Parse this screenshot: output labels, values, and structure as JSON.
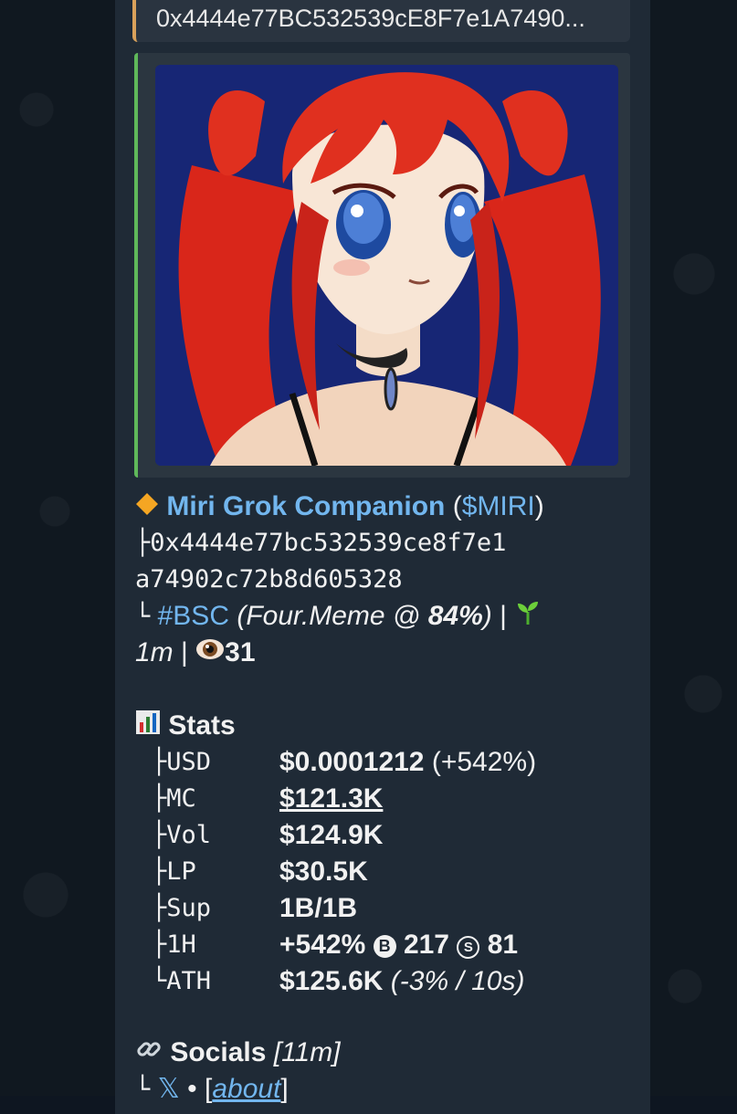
{
  "reply": {
    "text": "0x4444e77BC532539cE8F7e1A7490..."
  },
  "token": {
    "name": "Miri Grok Companion",
    "ticker": "$MIRI",
    "address_line1": "0x4444e77bc532539ce8f7e1",
    "address_line2": "a74902c72b8d605328",
    "chain": "#BSC",
    "launchpad": "(Four.Meme @ ",
    "progress": "84%",
    "progress_close": ")",
    "age": "1m",
    "views": "31"
  },
  "stats": {
    "heading": "Stats",
    "rows": [
      {
        "key": "USD",
        "value": "$0.0001212",
        "extra": "(+542%)"
      },
      {
        "key": "MC",
        "value": "$121.3K"
      },
      {
        "key": "Vol",
        "value": "$124.9K"
      },
      {
        "key": "LP",
        "value": "$30.5K"
      },
      {
        "key": "Sup",
        "value": "1B/1B"
      },
      {
        "key": "1H",
        "value": "+542%",
        "buys": "217",
        "sells": "81"
      },
      {
        "key": "ATH",
        "value": "$125.6K",
        "extra": "(-3% / 10s)"
      }
    ]
  },
  "socials": {
    "heading": "Socials",
    "age": "[11m]",
    "x_label": "𝕏",
    "about": "about"
  },
  "colors": {
    "link": "#72b6ee",
    "reply_accent": "#d9a15b",
    "media_accent": "#5fb85a"
  }
}
